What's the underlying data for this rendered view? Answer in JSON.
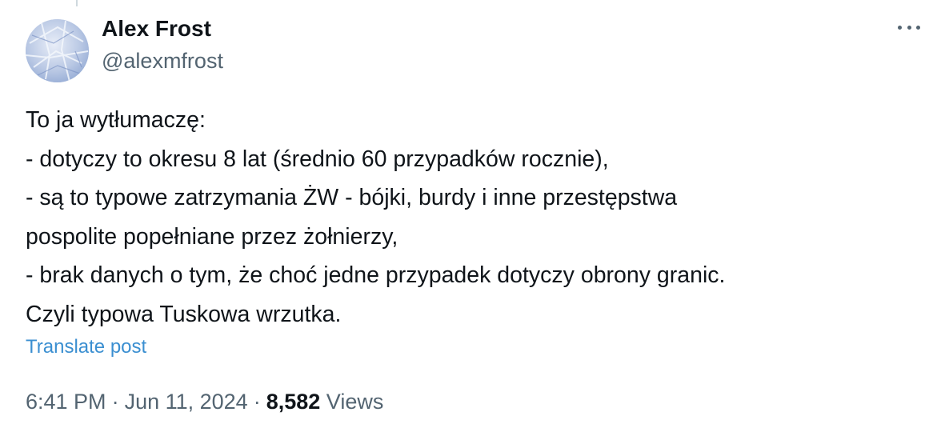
{
  "author": {
    "name": "Alex Frost",
    "handle": "@alexmfrost",
    "avatar_icon": "ice-crystal-avatar"
  },
  "more_icon": "more-horizontal-icon",
  "post": {
    "lines": [
      "To ja wytłumaczę:",
      "- dotyczy to okresu 8 lat (średnio 60 przypadków rocznie),",
      "- są to typowe zatrzymania ŻW - bójki, burdy i inne przestępstwa",
      "pospolite popełniane przez żołnierzy,",
      "- brak danych o tym, że choć jedne przypadek dotyczy  obrony granic.",
      "Czyli typowa Tuskowa wrzutka."
    ],
    "translate_label": "Translate post"
  },
  "meta": {
    "time": "6:41 PM",
    "separator": "·",
    "date": "Jun 11, 2024",
    "views_count": "8,582",
    "views_label": "Views"
  },
  "colors": {
    "text": "#0f1419",
    "secondary": "#536471",
    "link": "#3b8fd1"
  }
}
